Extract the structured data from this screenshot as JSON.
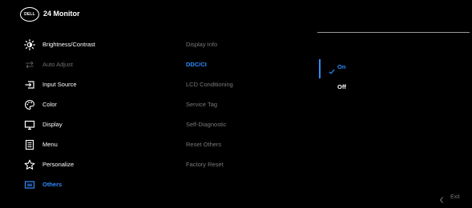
{
  "header": {
    "logo": "DELL",
    "title": "24 Monitor"
  },
  "menu": [
    {
      "label": "Brightness/Contrast",
      "icon": "brightness-icon",
      "state": "normal"
    },
    {
      "label": "Auto Adjust",
      "icon": "auto-adjust-icon",
      "state": "disabled"
    },
    {
      "label": "Input Source",
      "icon": "input-source-icon",
      "state": "normal"
    },
    {
      "label": "Color",
      "icon": "color-palette-icon",
      "state": "normal"
    },
    {
      "label": "Display",
      "icon": "display-icon",
      "state": "normal"
    },
    {
      "label": "Menu",
      "icon": "menu-icon",
      "state": "normal"
    },
    {
      "label": "Personalize",
      "icon": "star-icon",
      "state": "normal"
    },
    {
      "label": "Others",
      "icon": "others-icon",
      "state": "active"
    }
  ],
  "submenu": [
    {
      "label": "Display Info"
    },
    {
      "label": "DDC/CI"
    },
    {
      "label": "LCD Conditioning"
    },
    {
      "label": "Service Tag"
    },
    {
      "label": "Self-Diagnostic"
    },
    {
      "label": "Reset Others"
    },
    {
      "label": "Factory Reset"
    }
  ],
  "options": {
    "on": "On",
    "off": "Off"
  },
  "footer": {
    "exit": "Exit"
  },
  "colors": {
    "accent": "#2e8cff",
    "background": "#000000",
    "disabled": "#6f6f6f"
  }
}
